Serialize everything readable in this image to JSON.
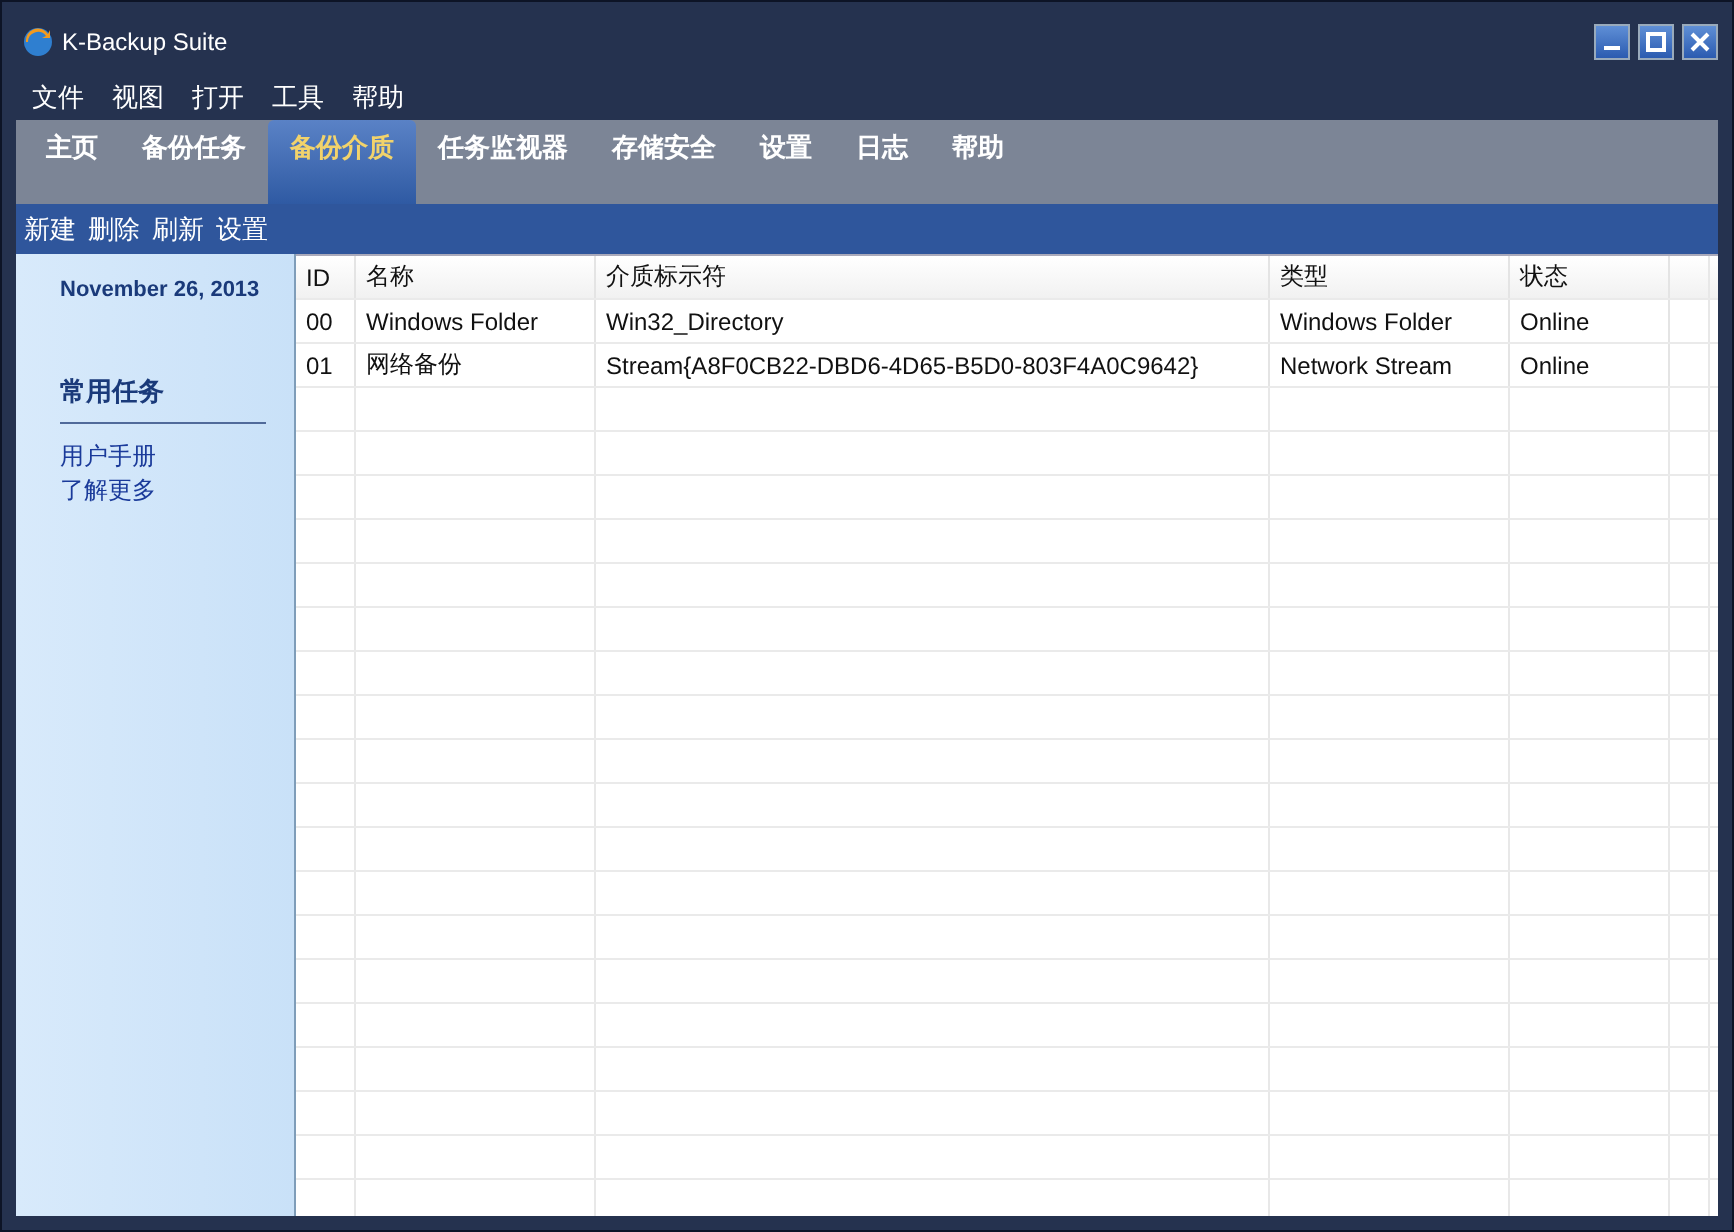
{
  "window": {
    "title": "K-Backup Suite"
  },
  "menu": [
    "文件",
    "视图",
    "打开",
    "工具",
    "帮助"
  ],
  "tabs": [
    {
      "label": "主页",
      "selected": false
    },
    {
      "label": "备份任务",
      "selected": false
    },
    {
      "label": "备份介质",
      "selected": true
    },
    {
      "label": "任务监视器",
      "selected": false
    },
    {
      "label": "存储安全",
      "selected": false
    },
    {
      "label": "设置",
      "selected": false
    },
    {
      "label": "日志",
      "selected": false
    },
    {
      "label": "帮助",
      "selected": false
    }
  ],
  "toolbar": [
    "新建",
    "删除",
    "刷新",
    "设置"
  ],
  "sidebar": {
    "date": "November 26, 2013",
    "section_title": "常用任务",
    "links": [
      "用户手册",
      "了解更多"
    ]
  },
  "table": {
    "columns": [
      "ID",
      "名称",
      "介质标示符",
      "类型",
      "状态"
    ],
    "rows": [
      [
        "00",
        "Windows Folder",
        "Win32_Directory",
        "Windows Folder",
        "Online"
      ],
      [
        "01",
        "网络备份",
        "Stream{A8F0CB22-DBD6-4D65-B5D0-803F4A0C9642}",
        "Network Stream",
        "Online"
      ]
    ]
  }
}
